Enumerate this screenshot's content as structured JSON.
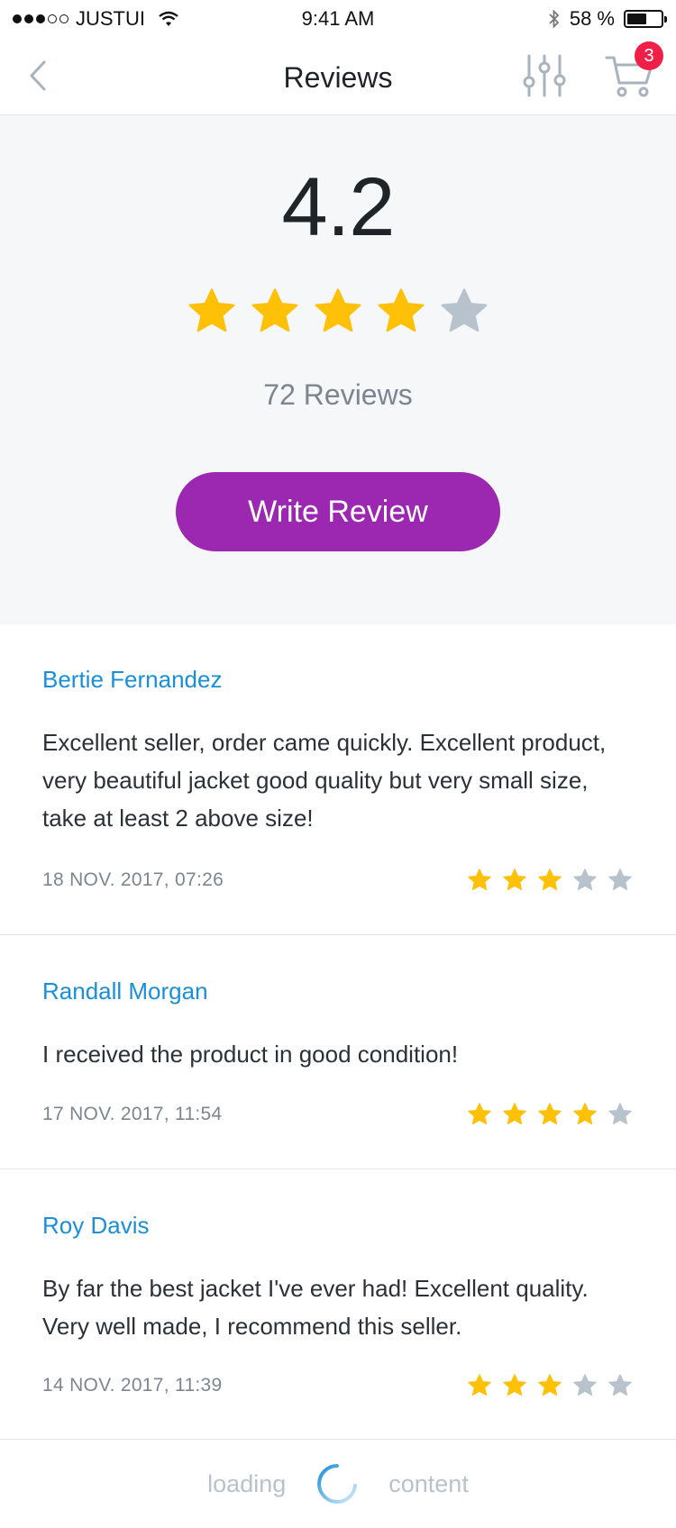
{
  "status_bar": {
    "carrier": "JUSTUI",
    "time": "9:41 AM",
    "battery": "58 %",
    "battery_level": 0.58
  },
  "nav": {
    "title": "Reviews",
    "cart_count": "3",
    "icons": [
      "chevron-left-icon",
      "filter-sliders-icon",
      "cart-icon"
    ]
  },
  "summary": {
    "rating": "4.2",
    "stars_filled": 4,
    "stars_total": 5,
    "count_text": "72 Reviews",
    "write_button": "Write Review"
  },
  "reviews": [
    {
      "author": "Bertie Fernandez",
      "text": "Excellent seller, order came quickly. Excellent product, very beautiful jacket good quality but very small size, take at least 2 above size!",
      "date": "18 NOV. 2017, 07:26",
      "stars": 3
    },
    {
      "author": "Randall Morgan",
      "text": "I received the product in good condition!",
      "date": "17 NOV. 2017, 11:54",
      "stars": 4
    },
    {
      "author": "Roy Davis",
      "text": "By far the best jacket I've ever had! Excellent quality. Very well made, I recommend this seller.",
      "date": "14 NOV. 2017, 11:39",
      "stars": 3
    }
  ],
  "loading": {
    "left_label": "loading",
    "right_label": "content"
  },
  "colors": {
    "star_on": "#FFC107",
    "star_off": "#B8C2CC",
    "accent": "#9C27B0",
    "author": "#1A8FD9",
    "badge": "#EF1F48"
  }
}
